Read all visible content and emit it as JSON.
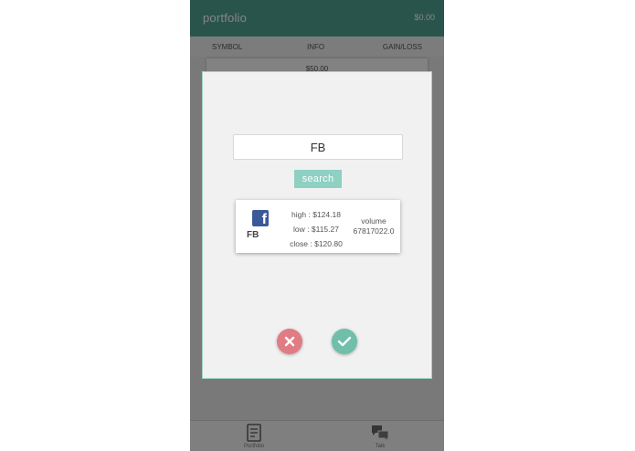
{
  "header": {
    "title": "portfolio",
    "balance": "$0.00"
  },
  "columns": {
    "symbol": "SYMBOL",
    "info": "INFO",
    "gain_loss": "GAIN/LOSS"
  },
  "portfolio_row": {
    "value": "$50.00"
  },
  "nav": {
    "portfolio_label": "Portfolio",
    "talk_label": "Talk"
  },
  "modal": {
    "search_value": "FB",
    "search_button": "search",
    "result": {
      "logo_icon": "facebook-icon",
      "symbol": "FB",
      "high": "high : $124.18",
      "low": "low : $115.27",
      "close": "close : $120.80",
      "volume_label": "volume",
      "volume_value": "67817022.0"
    },
    "cancel_icon": "close-icon",
    "confirm_icon": "check-icon"
  },
  "colors": {
    "brand": "#4fa293",
    "search_button": "#8ed0c1",
    "cancel": "#e07c84",
    "confirm": "#6fbfaa",
    "facebook": "#3b5998"
  }
}
